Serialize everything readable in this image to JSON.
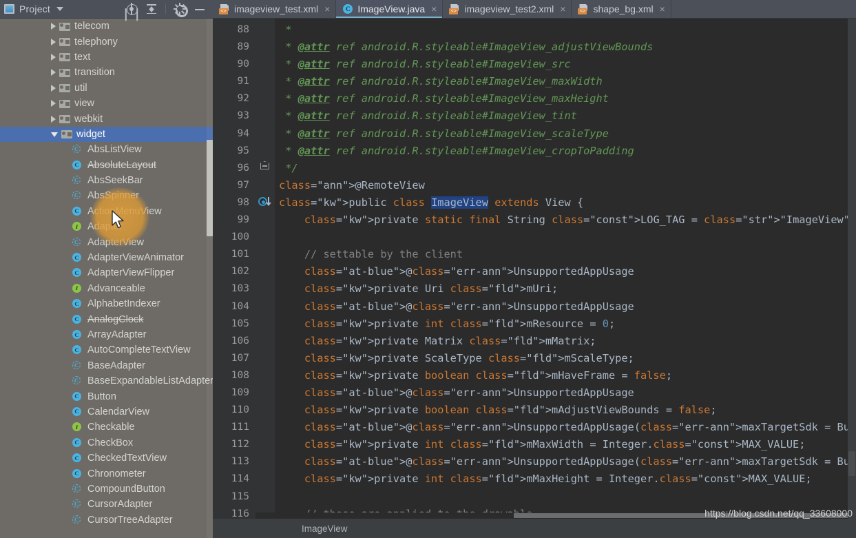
{
  "panel": {
    "title": "Project",
    "icons": [
      {
        "name": "locate-icon",
        "label": "Select Opened File"
      },
      {
        "name": "collapse-all-icon",
        "label": "Collapse All"
      },
      {
        "name": "gear-icon",
        "label": "Settings"
      },
      {
        "name": "minimize-icon",
        "label": "Hide"
      }
    ]
  },
  "tree": {
    "packages": [
      {
        "label": "telecom",
        "expanded": false
      },
      {
        "label": "telephony",
        "expanded": false
      },
      {
        "label": "text",
        "expanded": false
      },
      {
        "label": "transition",
        "expanded": false
      },
      {
        "label": "util",
        "expanded": false
      },
      {
        "label": "view",
        "expanded": false
      },
      {
        "label": "webkit",
        "expanded": false
      },
      {
        "label": "widget",
        "expanded": true,
        "selected": true
      }
    ],
    "classes": [
      {
        "label": "AbsListView",
        "kind": "abstract",
        "deprecated": false
      },
      {
        "label": "AbsoluteLayout",
        "kind": "class",
        "deprecated": true
      },
      {
        "label": "AbsSeekBar",
        "kind": "abstract",
        "deprecated": false
      },
      {
        "label": "AbsSpinner",
        "kind": "abstract",
        "deprecated": false
      },
      {
        "label": "ActionMenuView",
        "kind": "class",
        "deprecated": false
      },
      {
        "label": "Adapter",
        "kind": "interface",
        "deprecated": false
      },
      {
        "label": "AdapterView",
        "kind": "abstract",
        "deprecated": false
      },
      {
        "label": "AdapterViewAnimator",
        "kind": "class",
        "deprecated": false
      },
      {
        "label": "AdapterViewFlipper",
        "kind": "class",
        "deprecated": false
      },
      {
        "label": "Advanceable",
        "kind": "interface",
        "deprecated": false
      },
      {
        "label": "AlphabetIndexer",
        "kind": "class",
        "deprecated": false
      },
      {
        "label": "AnalogClock",
        "kind": "class",
        "deprecated": true
      },
      {
        "label": "ArrayAdapter",
        "kind": "class",
        "deprecated": false
      },
      {
        "label": "AutoCompleteTextView",
        "kind": "class",
        "deprecated": false
      },
      {
        "label": "BaseAdapter",
        "kind": "abstract",
        "deprecated": false
      },
      {
        "label": "BaseExpandableListAdapter",
        "kind": "abstract",
        "deprecated": false
      },
      {
        "label": "Button",
        "kind": "class",
        "deprecated": false
      },
      {
        "label": "CalendarView",
        "kind": "class",
        "deprecated": false
      },
      {
        "label": "Checkable",
        "kind": "interface",
        "deprecated": false
      },
      {
        "label": "CheckBox",
        "kind": "class",
        "deprecated": false
      },
      {
        "label": "CheckedTextView",
        "kind": "class",
        "deprecated": false
      },
      {
        "label": "Chronometer",
        "kind": "class",
        "deprecated": false
      },
      {
        "label": "CompoundButton",
        "kind": "abstract",
        "deprecated": false
      },
      {
        "label": "CursorAdapter",
        "kind": "abstract",
        "deprecated": false
      },
      {
        "label": "CursorTreeAdapter",
        "kind": "abstract",
        "deprecated": false
      }
    ]
  },
  "tabs": [
    {
      "label": "imageview_test.xml",
      "type": "xml",
      "active": false,
      "close": "×"
    },
    {
      "label": "ImageView.java",
      "type": "java",
      "active": true,
      "close": "×"
    },
    {
      "label": "imageview_test2.xml",
      "type": "xml",
      "active": false,
      "close": "×"
    },
    {
      "label": "shape_bg.xml",
      "type": "xml",
      "active": false,
      "close": "×"
    }
  ],
  "editor": {
    "first_line": 88,
    "line_numbers": [
      88,
      89,
      90,
      91,
      92,
      93,
      94,
      95,
      96,
      97,
      98,
      99,
      100,
      101,
      102,
      103,
      104,
      105,
      106,
      107,
      108,
      109,
      110,
      111,
      112,
      113,
      114,
      115,
      116
    ],
    "caret_line": 98,
    "selected_token": "ImageView",
    "lines": [
      " *",
      " * @attr ref android.R.styleable#ImageView_adjustViewBounds",
      " * @attr ref android.R.styleable#ImageView_src",
      " * @attr ref android.R.styleable#ImageView_maxWidth",
      " * @attr ref android.R.styleable#ImageView_maxHeight",
      " * @attr ref android.R.styleable#ImageView_tint",
      " * @attr ref android.R.styleable#ImageView_scaleType",
      " * @attr ref android.R.styleable#ImageView_cropToPadding",
      " */",
      "@RemoteView",
      "public class ImageView extends View {",
      "    private static final String LOG_TAG = \"ImageView\";",
      "",
      "    // settable by the client",
      "    @UnsupportedAppUsage",
      "    private Uri mUri;",
      "    @UnsupportedAppUsage",
      "    private int mResource = 0;",
      "    private Matrix mMatrix;",
      "    private ScaleType mScaleType;",
      "    private boolean mHaveFrame = false;",
      "    @UnsupportedAppUsage",
      "    private boolean mAdjustViewBounds = false;",
      "    @UnsupportedAppUsage(maxTargetSdk = Build.VERSION_CODES.P)",
      "    private int mMaxWidth = Integer.MAX_VALUE;",
      "    @UnsupportedAppUsage(maxTargetSdk = Build.VERSION_CODES.P)",
      "    private int mMaxHeight = Integer.MAX_VALUE;",
      "",
      "    // these are applied to the drawable"
    ]
  },
  "status": {
    "breadcrumb": "ImageView",
    "watermark": "https://blog.csdn.net/qq_33608000"
  },
  "colors": {
    "panel_bg": "#6e6b66",
    "editor_bg": "#2b2b2b",
    "gutter_bg": "#313335",
    "tab_bg": "#4b5059",
    "selection_blue": "#4b6eaf",
    "keyword_orange": "#cc7832",
    "annotation_yellow": "#bbb529",
    "javadoc_green": "#629755",
    "string_green": "#6a8759",
    "number_blue": "#6897bb",
    "field_purple": "#9876aa",
    "accent_cyan": "#7ab3c9"
  }
}
